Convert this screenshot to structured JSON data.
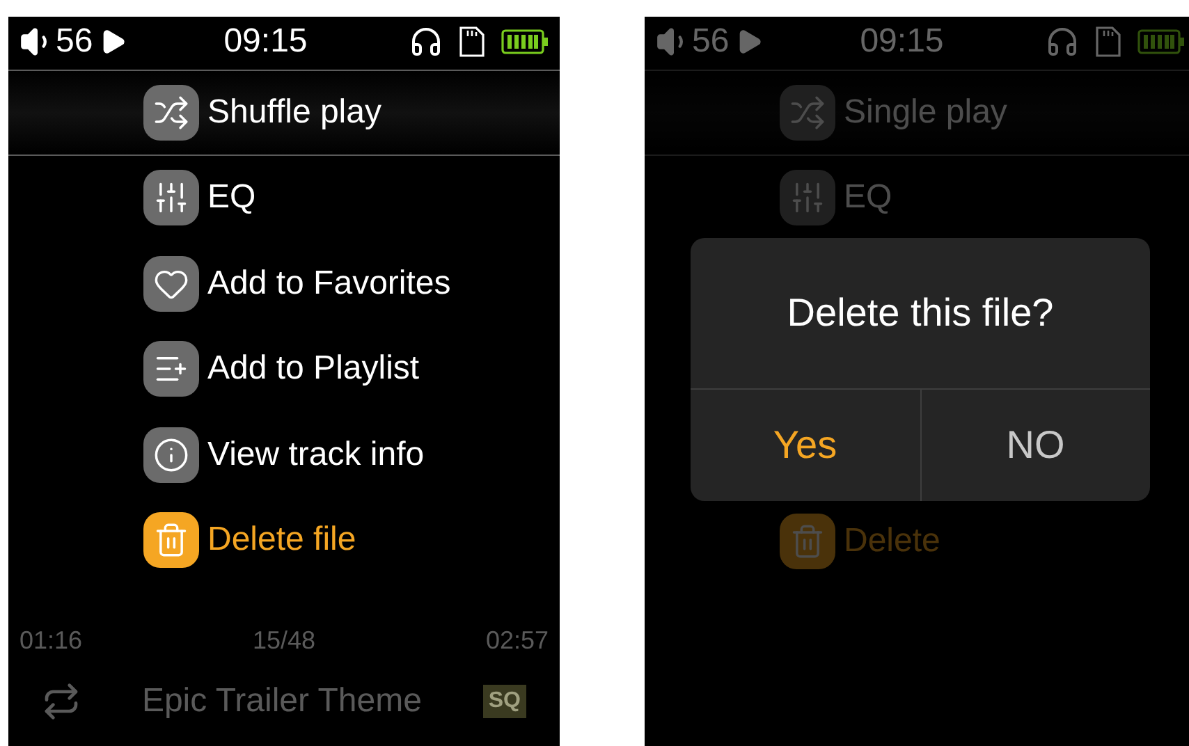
{
  "screens": [
    {
      "dimmed": false,
      "status_bar": {
        "volume": "56",
        "time": "09:15"
      },
      "menu": [
        {
          "kind": "option",
          "label": "Shuffle play",
          "selected": true,
          "warning": false
        },
        {
          "kind": "option",
          "label": "EQ",
          "selected": false,
          "warning": false
        },
        {
          "kind": "option",
          "label": "Add to Favorites",
          "selected": false,
          "warning": false
        },
        {
          "kind": "option",
          "label": "Add to Playlist",
          "selected": false,
          "warning": false
        },
        {
          "kind": "option",
          "label": "View track info",
          "selected": false,
          "warning": false
        },
        {
          "kind": "option",
          "label": "Delete file",
          "selected": false,
          "warning": true
        }
      ],
      "now_playing": {
        "elapsed": "01:16",
        "position": "15/48",
        "duration": "02:57",
        "title": "Epic Trailer Theme",
        "quality": "SQ"
      }
    },
    {
      "dimmed": true,
      "status_bar": {
        "volume": "56",
        "time": "09:15"
      },
      "menu": [
        {
          "kind": "option",
          "label": "Single play",
          "selected": true,
          "warning": false
        },
        {
          "kind": "option",
          "label": "EQ",
          "selected": false,
          "warning": false
        },
        {
          "kind": "dialog",
          "title": "Delete this file?",
          "buttons": [
            {
              "label": "Yes",
              "selected": true
            },
            {
              "label": "NO",
              "selected": false
            }
          ]
        },
        {
          "kind": "option",
          "label": "Delete",
          "selected": false,
          "warning": true
        }
      ]
    }
  ]
}
